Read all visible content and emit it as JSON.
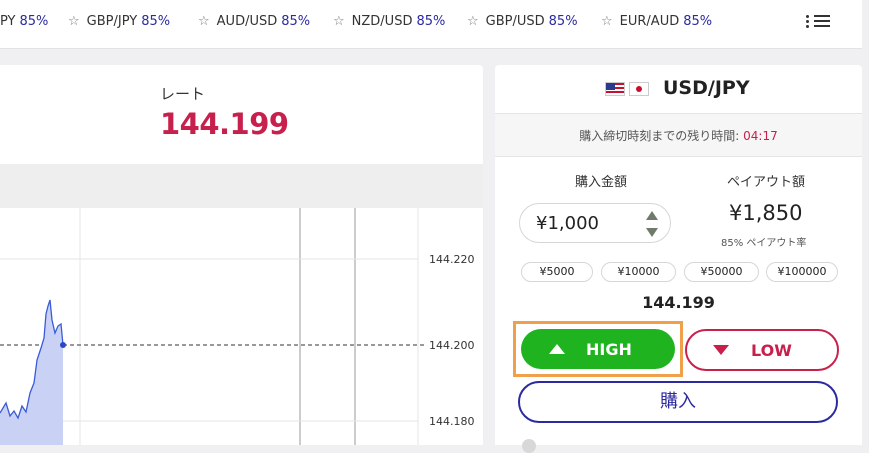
{
  "ticker": [
    {
      "pair": "PY",
      "pct": "85%",
      "show_star": false
    },
    {
      "pair": "GBP/JPY",
      "pct": "85%",
      "show_star": true
    },
    {
      "pair": "AUD/USD",
      "pct": "85%",
      "show_star": true
    },
    {
      "pair": "NZD/USD",
      "pct": "85%",
      "show_star": true
    },
    {
      "pair": "GBP/USD",
      "pct": "85%",
      "show_star": true
    },
    {
      "pair": "EUR/AUD",
      "pct": "85%",
      "show_star": true
    }
  ],
  "rate": {
    "label": "レート",
    "value": "144.199"
  },
  "chart_axis": {
    "labels": [
      "144.220",
      "144.200",
      "144.180"
    ]
  },
  "trade": {
    "pair": "USD/JPY",
    "deadline_label": "購入締切時刻までの残り時間:",
    "deadline_time": "04:17",
    "amount_label": "購入金額",
    "payout_label": "ペイアウト額",
    "amount_value": "¥1,000",
    "payout_value": "¥1,850",
    "payout_note": "85% ペイアウト率",
    "presets": [
      "¥5000",
      "¥10000",
      "¥50000",
      "¥100000"
    ],
    "current_rate": "144.199",
    "high_label": "HIGH",
    "low_label": "LOW",
    "buy_label": "購入"
  },
  "colors": {
    "accent_red": "#c8204d",
    "accent_blue": "#2b2aa0",
    "high_green": "#1fb31f",
    "highlight": "#f0a04b"
  }
}
